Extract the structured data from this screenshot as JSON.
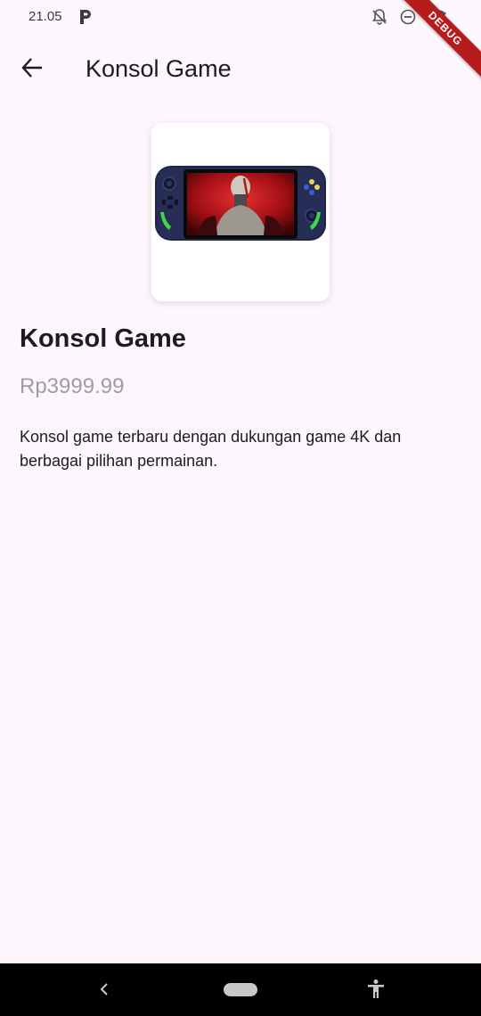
{
  "status_bar": {
    "time": "21.05",
    "icons": [
      "parking-app-icon",
      "notifications-off-icon",
      "do-not-disturb-icon",
      "wifi-icon"
    ]
  },
  "debug_banner": {
    "label": "DEBUG"
  },
  "app_bar": {
    "title": "Konsol Game",
    "back_icon": "arrow-back-icon"
  },
  "product": {
    "image_alt": "handheld-game-console",
    "name": "Konsol Game",
    "price": "Rp3999.99",
    "description": "Konsol game terbaru dengan dukungan game 4K dan berbagai pilihan permainan."
  },
  "colors": {
    "background": "#fdf6fc",
    "card": "#ffffff",
    "price": "#9e9e9e",
    "debug_banner": "#b71c1c",
    "nav_bar": "#000000"
  },
  "nav_bar": {
    "icons": [
      "nav-back-icon",
      "home-pill-icon",
      "accessibility-icon"
    ]
  }
}
